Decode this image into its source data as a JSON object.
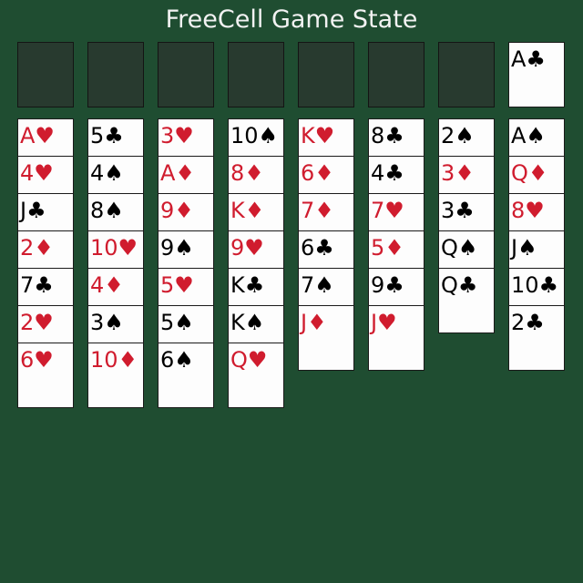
{
  "title": "FreeCell Game State",
  "colors": {
    "table": "#1f4d31",
    "empty_slot": "#283a2f",
    "card_face": "#fdfdfd",
    "red_suit": "#d01c2e",
    "black_suit": "#000000",
    "title_text": "#f2f2f2"
  },
  "free_cells": [
    {
      "label": "free-cell-1",
      "card": null
    },
    {
      "label": "free-cell-2",
      "card": null
    },
    {
      "label": "free-cell-3",
      "card": null
    },
    {
      "label": "free-cell-4",
      "card": null
    }
  ],
  "foundations": [
    {
      "label": "foundation-1",
      "card": null
    },
    {
      "label": "foundation-2",
      "card": null
    },
    {
      "label": "foundation-3",
      "card": null
    },
    {
      "label": "foundation-4",
      "card": {
        "rank": "A",
        "suit": "♣",
        "color": "black"
      }
    }
  ],
  "tableau": [
    [
      {
        "rank": "A",
        "suit": "♥",
        "color": "red"
      },
      {
        "rank": "4",
        "suit": "♥",
        "color": "red"
      },
      {
        "rank": "J",
        "suit": "♣",
        "color": "black"
      },
      {
        "rank": "2",
        "suit": "♦",
        "color": "red"
      },
      {
        "rank": "7",
        "suit": "♣",
        "color": "black"
      },
      {
        "rank": "2",
        "suit": "♥",
        "color": "red"
      },
      {
        "rank": "6",
        "suit": "♥",
        "color": "red"
      }
    ],
    [
      {
        "rank": "5",
        "suit": "♣",
        "color": "black"
      },
      {
        "rank": "4",
        "suit": "♠",
        "color": "black"
      },
      {
        "rank": "8",
        "suit": "♠",
        "color": "black"
      },
      {
        "rank": "10",
        "suit": "♥",
        "color": "red"
      },
      {
        "rank": "4",
        "suit": "♦",
        "color": "red"
      },
      {
        "rank": "3",
        "suit": "♠",
        "color": "black"
      },
      {
        "rank": "10",
        "suit": "♦",
        "color": "red"
      }
    ],
    [
      {
        "rank": "3",
        "suit": "♥",
        "color": "red"
      },
      {
        "rank": "A",
        "suit": "♦",
        "color": "red"
      },
      {
        "rank": "9",
        "suit": "♦",
        "color": "red"
      },
      {
        "rank": "9",
        "suit": "♠",
        "color": "black"
      },
      {
        "rank": "5",
        "suit": "♥",
        "color": "red"
      },
      {
        "rank": "5",
        "suit": "♠",
        "color": "black"
      },
      {
        "rank": "6",
        "suit": "♠",
        "color": "black"
      }
    ],
    [
      {
        "rank": "10",
        "suit": "♠",
        "color": "black"
      },
      {
        "rank": "8",
        "suit": "♦",
        "color": "red"
      },
      {
        "rank": "K",
        "suit": "♦",
        "color": "red"
      },
      {
        "rank": "9",
        "suit": "♥",
        "color": "red"
      },
      {
        "rank": "K",
        "suit": "♣",
        "color": "black"
      },
      {
        "rank": "K",
        "suit": "♠",
        "color": "black"
      },
      {
        "rank": "Q",
        "suit": "♥",
        "color": "red"
      }
    ],
    [
      {
        "rank": "K",
        "suit": "♥",
        "color": "red"
      },
      {
        "rank": "6",
        "suit": "♦",
        "color": "red"
      },
      {
        "rank": "7",
        "suit": "♦",
        "color": "red"
      },
      {
        "rank": "6",
        "suit": "♣",
        "color": "black"
      },
      {
        "rank": "7",
        "suit": "♠",
        "color": "black"
      },
      {
        "rank": "J",
        "suit": "♦",
        "color": "red"
      }
    ],
    [
      {
        "rank": "8",
        "suit": "♣",
        "color": "black"
      },
      {
        "rank": "4",
        "suit": "♣",
        "color": "black"
      },
      {
        "rank": "7",
        "suit": "♥",
        "color": "red"
      },
      {
        "rank": "5",
        "suit": "♦",
        "color": "red"
      },
      {
        "rank": "9",
        "suit": "♣",
        "color": "black"
      },
      {
        "rank": "J",
        "suit": "♥",
        "color": "red"
      }
    ],
    [
      {
        "rank": "2",
        "suit": "♠",
        "color": "black"
      },
      {
        "rank": "3",
        "suit": "♦",
        "color": "red"
      },
      {
        "rank": "3",
        "suit": "♣",
        "color": "black"
      },
      {
        "rank": "Q",
        "suit": "♠",
        "color": "black"
      },
      {
        "rank": "Q",
        "suit": "♣",
        "color": "black"
      }
    ],
    [
      {
        "rank": "A",
        "suit": "♠",
        "color": "black"
      },
      {
        "rank": "Q",
        "suit": "♦",
        "color": "red"
      },
      {
        "rank": "8",
        "suit": "♥",
        "color": "red"
      },
      {
        "rank": "J",
        "suit": "♠",
        "color": "black"
      },
      {
        "rank": "10",
        "suit": "♣",
        "color": "black"
      },
      {
        "rank": "2",
        "suit": "♣",
        "color": "black"
      }
    ]
  ]
}
